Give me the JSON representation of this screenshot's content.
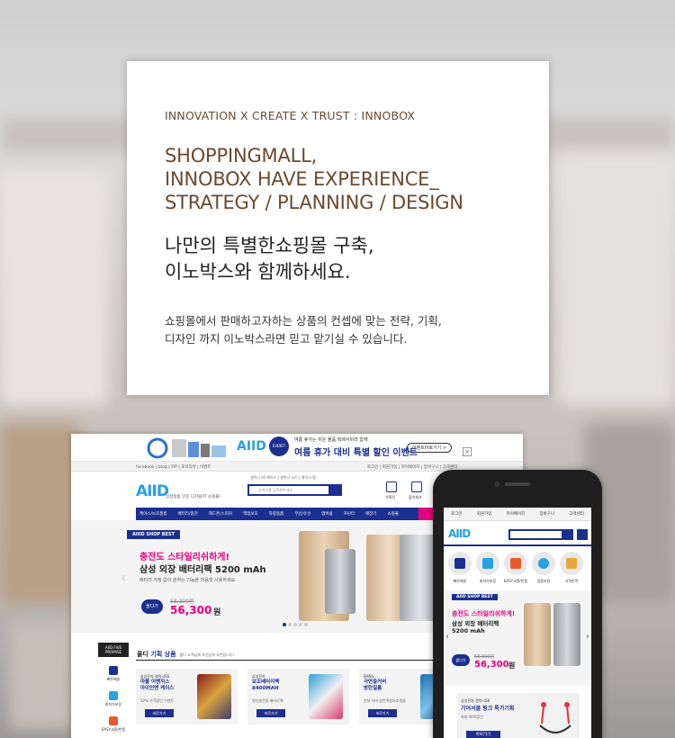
{
  "card": {
    "eyebrow": "INNOVATION X CREATE X TRUST  :  INNOBOX",
    "headline": [
      "SHOPPINGMALL,",
      "INNOBOX HAVE EXPERIENCE_",
      "STRATEGY / PLANNING / DESIGN"
    ],
    "ko_title": [
      "나만의 특별한쇼핑몰 구축,",
      "이노박스와 함께하세요."
    ],
    "ko_desc": [
      "쇼핑몰에서 판매하고자하는 상품의 컨셉에 맞는 전략, 기획,",
      "디자인 까지 이노박스라면 믿고 맡기실 수 있습니다."
    ]
  },
  "desktop": {
    "top_banner": {
      "logo_main": "AII",
      "logo_accent": "D",
      "disc_label": "EVENT!",
      "promo_small": "여름 휴가는 쉬운 물품 택배서비라 함께",
      "promo_main": "여름 휴가 대비 특별 할인 이벤트",
      "promo_button": "이벤트바로가기 >",
      "close": "×"
    },
    "util_left": "facebook  |  blog  |  TIP  |  포토리뷰  |  이벤트",
    "util_right": "로그인  |  회원가입  |  마이페이지  |  장바구니  |  고객센터",
    "logo_main": "AII",
    "logo_accent": "D",
    "tagline": "삼성정품 인증 디지털/IT 쇼핑몰!",
    "header_links": "갤럭시 s6 케이스 | 갤럭시 노트 | 갤럭시 탭",
    "search_placeholder": "검색어를 입력해주세요",
    "header_icons": [
      "기획전",
      "출석체크"
    ],
    "nav": [
      "케이스/보호필름",
      "배터리/충전",
      "헤드폰/스피커",
      "액정보호",
      "차량용품",
      "무선/유선",
      "멤버쉽",
      "프린터",
      "매장기",
      "쇼핑몰"
    ],
    "hero": {
      "badge": "AIIID SHOP BEST",
      "title1": "충전도 스타일리쉬하게!",
      "title2": "삼성 외장 배터리팩 5200 mAh",
      "desc": "배터리 걱정 없이 원하는 기능을 마음껏 사용하세요.",
      "pill": "올디가",
      "old_price": "58,300원",
      "price": "56,300",
      "won": "원",
      "arrow": "‹"
    },
    "side": {
      "promise": [
        "AIID FIVE",
        "PROMISE"
      ],
      "items": [
        "빠른배송",
        "최저가보장",
        "EASY교환/반품"
      ]
    },
    "rec_title_bold": "기획 상품",
    "rec_title_prefix": "올디 ",
    "rec_sub": "올디 고객님께 자신있게 추천합니다!",
    "products": [
      {
        "brand": "삼성전자 갤럭시S6",
        "name": [
          "마블 어벤저스",
          "아이언맨 케이스"
        ],
        "desc": "10% 가격할인 이벤트",
        "btn": "바로가기"
      },
      {
        "brand": "삼성전자",
        "name": [
          "보조배터리팩",
          "8400MAH"
        ],
        "desc": "멀티충전용 배터리팩",
        "btn": "바로가기"
      },
      {
        "brand": "BANS",
        "name": [
          "극연출커버",
          "방탄필름"
        ],
        "desc": "전체 커버 방탄액정보호필름",
        "btn": "바로가기"
      }
    ]
  },
  "phone": {
    "top_links": [
      "로그인",
      "회원가입",
      "마이페이지",
      "장바구니",
      "고객센터"
    ],
    "logo_main": "AII",
    "logo_accent": "D",
    "icons": [
      "빠른배송",
      "최저가보장",
      "EASY교환/반품",
      "정품보장",
      "고객만족"
    ],
    "hero": {
      "badge": "AIID SHOP BEST",
      "title1": "충전도 스타일리쉬하게!",
      "title2": "삼성 외장 배터리팩",
      "title3": "5200 mAh",
      "pill": "올디가",
      "old_price": "58,300원",
      "price": "56,300",
      "won": "원"
    },
    "card": {
      "brand": "삼성전자 갤럭시S6",
      "line1": "기어서클 핑크 특가기획",
      "desc": "최대 40%할인",
      "btn": "바로가기"
    }
  },
  "colors": {
    "brand_navy": "#1c2f8e",
    "brand_pink": "#e5007e",
    "headline_brown": "#6b4a2e"
  }
}
